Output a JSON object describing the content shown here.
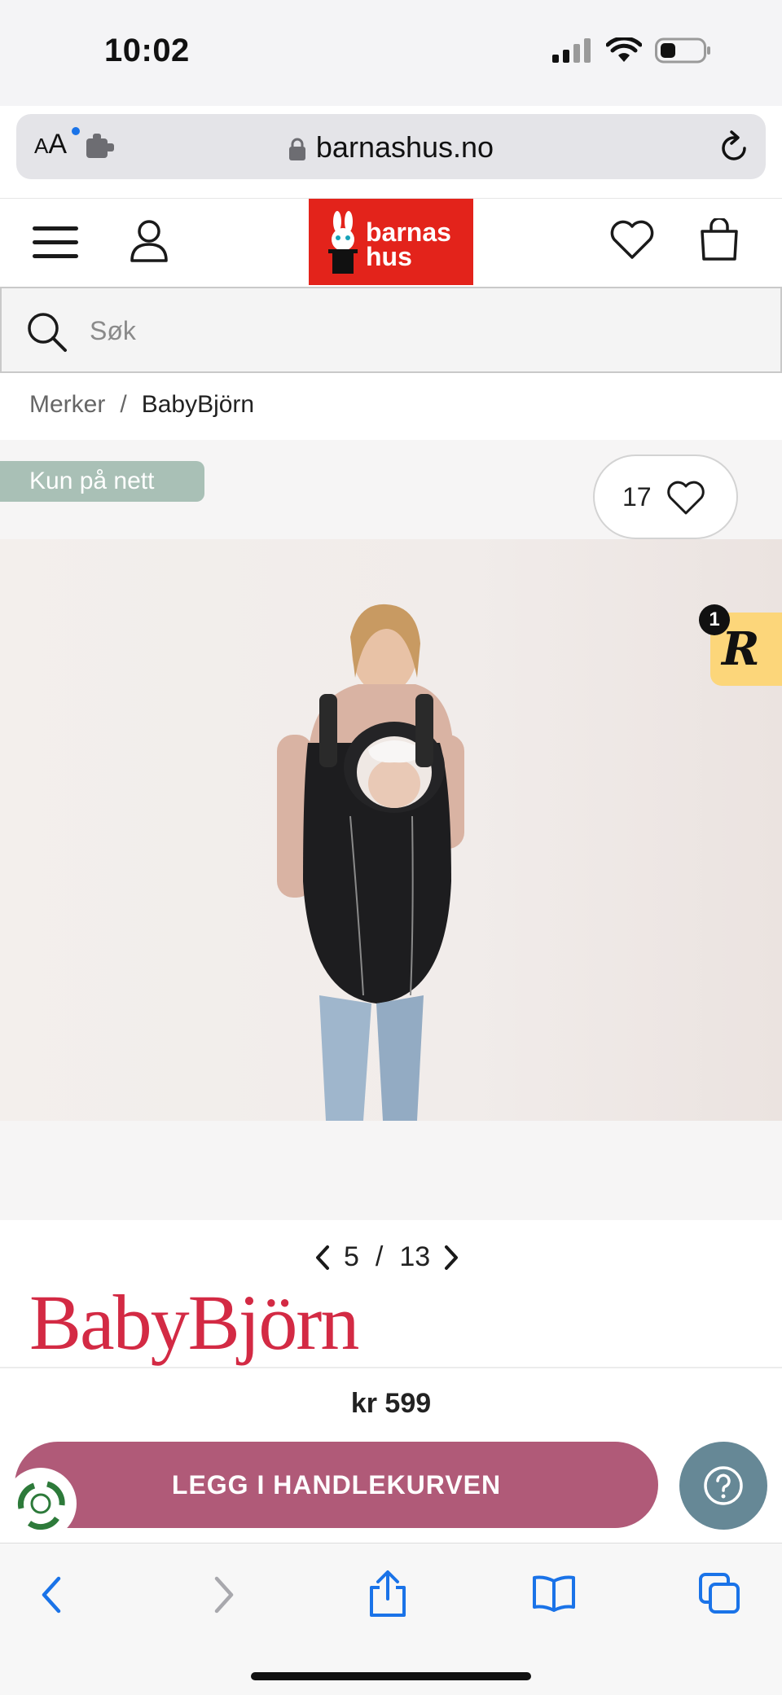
{
  "status_bar": {
    "time": "10:02"
  },
  "browser": {
    "aa_label": "A",
    "aa_label_big": "A",
    "url": "barnashus.no"
  },
  "header": {
    "logo_line1": "barnas",
    "logo_line2": "hus",
    "brand_color": "#e3231b"
  },
  "search": {
    "placeholder": "Søk"
  },
  "breadcrumb": {
    "parent": "Merker",
    "separator": "/",
    "current": "BabyBjörn"
  },
  "product": {
    "badge": "Kun på nett",
    "wishlist_count": "17",
    "rewards_count": "1",
    "rewards_letter": "R",
    "image_index": "5",
    "image_total": "13",
    "brand": "BabyBjörn",
    "price": "kr 599",
    "add_to_cart_label": "LEGG I HANDLEKURVEN"
  },
  "colors": {
    "badge": "#a9c0b6",
    "cart_button": "#b05a78",
    "help_button": "#668896",
    "brand_logo": "#d32a44",
    "rewards_badge": "#fcd67a"
  }
}
